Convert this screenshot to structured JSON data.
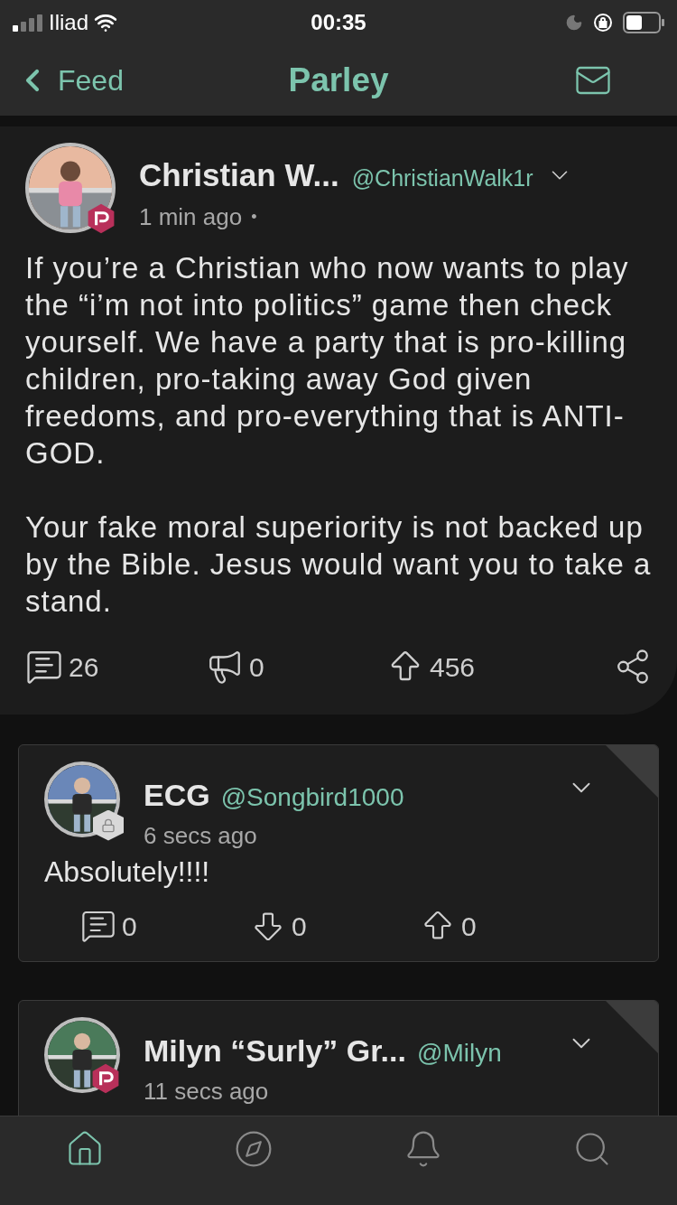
{
  "status_bar": {
    "carrier": "Iliad",
    "time": "00:35"
  },
  "nav": {
    "back": "Feed",
    "title": "Parley"
  },
  "post": {
    "name": "Christian W...",
    "handle": "@ChristianWalk1r",
    "time": "1 min ago",
    "separator": "•",
    "badge": {
      "kind": "parley"
    },
    "paragraphs": [
      "If you’re a Christian who now wants to play the “i’m not into politics” game then check yourself. We have a party that is pro-killing children, pro-taking away God given freedoms, and pro-everything that is ANTI-GOD.",
      "Your fake moral superiority is not backed up by the Bible. Jesus would want you to take a stand."
    ],
    "stats": [
      {
        "kind": "comments",
        "count": "26"
      },
      {
        "kind": "echo",
        "count": "0"
      },
      {
        "kind": "upvote",
        "count": "456"
      }
    ]
  },
  "comments": [
    {
      "name": "ECG",
      "handle": "@Songbird1000",
      "time": "6 secs ago",
      "badge": {
        "kind": "lock"
      },
      "text": "Absolutely!!!!",
      "stats": [
        {
          "kind": "comments",
          "count": "0"
        },
        {
          "kind": "downvote",
          "count": "0"
        },
        {
          "kind": "upvote",
          "count": "0"
        }
      ]
    },
    {
      "name": "Milyn “Surly” Gr...",
      "handle": "@Milyn",
      "time": "11 secs ago",
      "badge": {
        "kind": "parley"
      }
    }
  ],
  "tab_bar": {
    "tabs": [
      {
        "kind": "home",
        "selected": true
      },
      {
        "kind": "explore",
        "selected": false
      },
      {
        "kind": "notifications",
        "selected": false
      },
      {
        "kind": "search",
        "selected": false
      }
    ]
  }
}
